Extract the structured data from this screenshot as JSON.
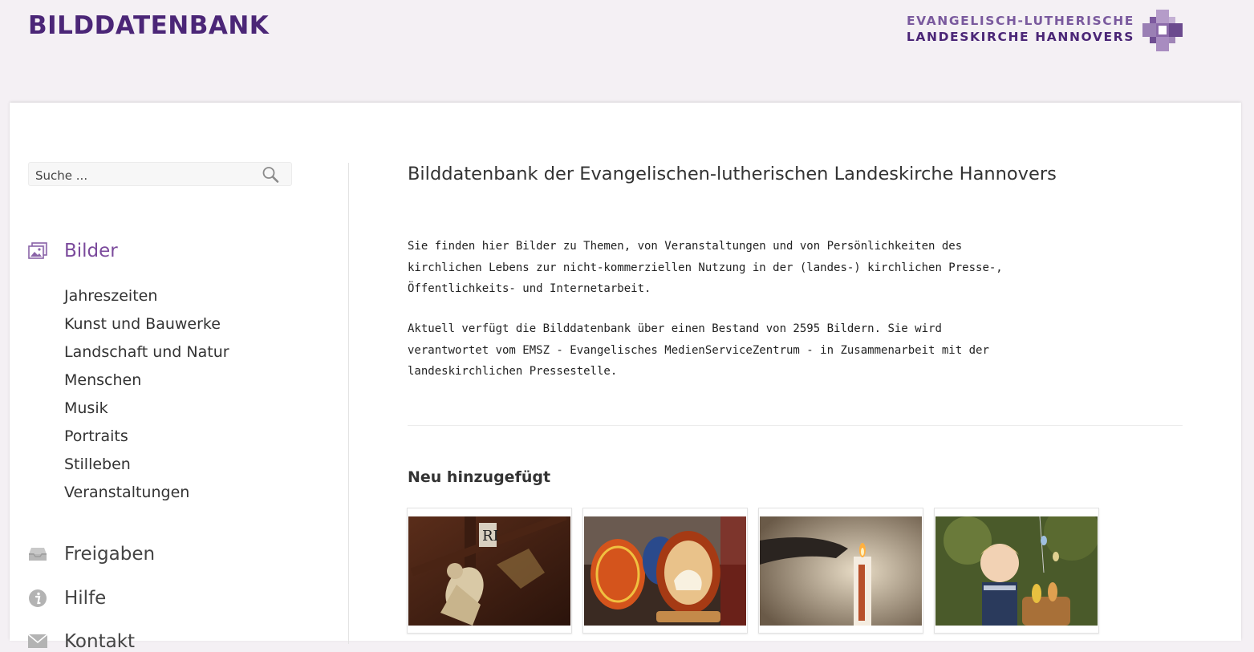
{
  "header": {
    "brand": "BILDDATENBANK",
    "logo_line1": "EVANGELISCH-LUTHERISCHE",
    "logo_line2": "LANDESKIRCHE HANNOVERS"
  },
  "search": {
    "placeholder": "Suche ...",
    "value": ""
  },
  "sidebar": {
    "main": [
      {
        "label": "Bilder",
        "icon": "pictures-icon"
      },
      {
        "label": "Freigaben",
        "icon": "inbox-tray-icon"
      },
      {
        "label": "Hilfe",
        "icon": "info-icon"
      },
      {
        "label": "Kontakt",
        "icon": "envelope-icon"
      }
    ],
    "subitems": [
      "Jahreszeiten",
      "Kunst und Bauwerke",
      "Landschaft und Natur",
      "Menschen",
      "Musik",
      "Portraits",
      "Stilleben",
      "Veranstaltungen"
    ]
  },
  "main": {
    "title": "Bilddatenbank der Evangelischen-lutherischen Landeskirche Hannovers",
    "paragraph1": [
      "Sie finden hier Bilder zu Themen, von Veranstaltungen und von Persönlichkeiten des",
      "kirchlichen Lebens zur nicht-kommerziellen Nutzung in der (landes-) kirchlichen Presse-,",
      "Öffentlichkeits- und Internetarbeit."
    ],
    "paragraph2": [
      "Aktuell verfügt die Bilddatenbank über einen Bestand von 2595 Bildern. Sie wird",
      "verantwortet vom EMSZ - Evangelisches MedienServiceZentrum - in Zusammenarbeit mit der",
      "landeskirchlichen Pressestelle."
    ],
    "section_title": "Neu hinzugefügt"
  },
  "colors": {
    "accent": "#7b4a9c",
    "brand": "#4b2677"
  }
}
